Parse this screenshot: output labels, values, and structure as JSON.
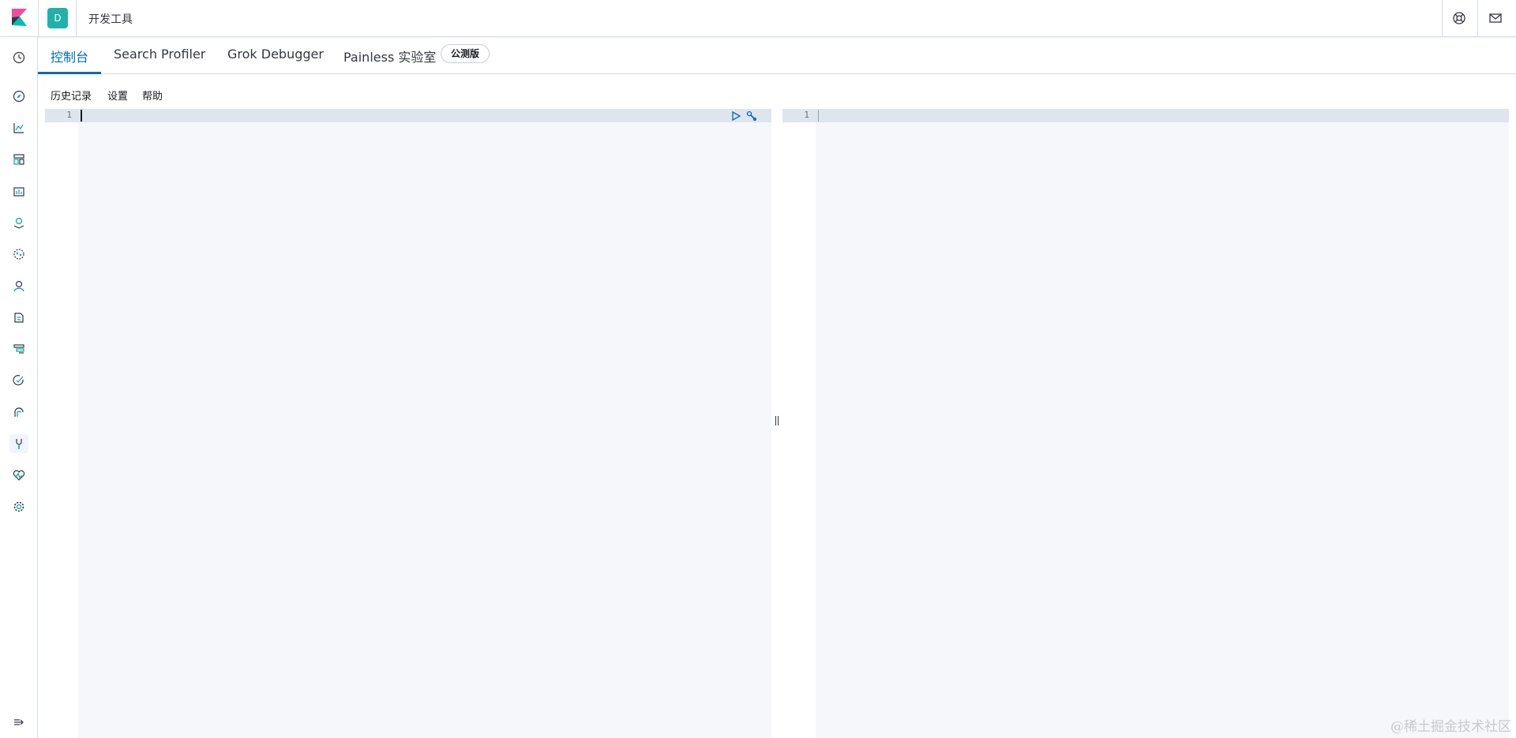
{
  "header": {
    "space_initial": "D",
    "breadcrumb": "开发工具",
    "icons": [
      "kibana-logo-icon",
      "help-icon",
      "mail-icon"
    ]
  },
  "leftnav": {
    "items": [
      {
        "name": "recently-viewed-icon"
      },
      {
        "name": "discover-icon"
      },
      {
        "name": "visualize-icon"
      },
      {
        "name": "dashboard-icon"
      },
      {
        "name": "canvas-icon"
      },
      {
        "name": "maps-icon"
      },
      {
        "name": "machine-learning-icon"
      },
      {
        "name": "infrastructure-icon"
      },
      {
        "name": "logs-icon"
      },
      {
        "name": "apm-icon"
      },
      {
        "name": "uptime-icon"
      },
      {
        "name": "siem-icon"
      },
      {
        "name": "dev-tools-icon",
        "active": true
      },
      {
        "name": "monitoring-icon"
      },
      {
        "name": "management-icon"
      }
    ],
    "collapse_icon": "collapse-nav-icon"
  },
  "tabs": [
    {
      "label": "控制台",
      "active": true
    },
    {
      "label": "Search Profiler"
    },
    {
      "label": "Grok Debugger"
    },
    {
      "label": "Painless 实验室"
    }
  ],
  "beta_badge": "公测版",
  "submenu": {
    "history": "历史记录",
    "settings": "设置",
    "help": "帮助"
  },
  "request_editor": {
    "line_number": "1",
    "actions": [
      "play-icon",
      "wrench-icon"
    ]
  },
  "response_editor": {
    "line_number": "1"
  },
  "watermark": "@稀土掘金技术社区",
  "colors": {
    "accent": "#006bb4",
    "space_badge": "#20b2aa",
    "editor_bg": "#f5f7fa",
    "active_line": "#dfe5ef"
  }
}
